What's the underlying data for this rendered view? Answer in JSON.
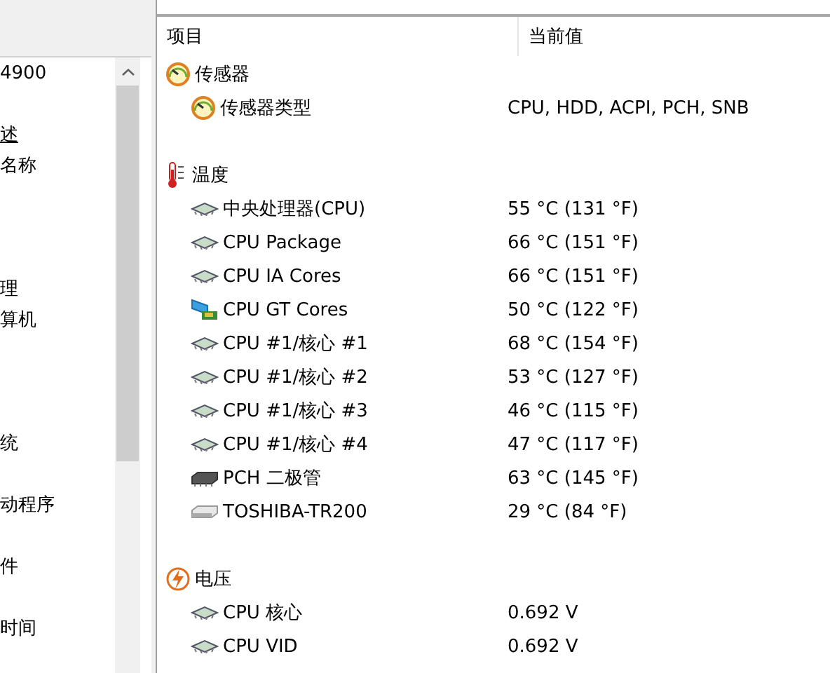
{
  "nav": {
    "items": [
      {
        "kind": "text",
        "label": "4900"
      },
      {
        "kind": "blank"
      },
      {
        "kind": "link",
        "label": "述"
      },
      {
        "kind": "text",
        "label": "名称"
      },
      {
        "kind": "blank"
      },
      {
        "kind": "blank"
      },
      {
        "kind": "blank"
      },
      {
        "kind": "text",
        "label": "理"
      },
      {
        "kind": "text",
        "label": "算机"
      },
      {
        "kind": "blank"
      },
      {
        "kind": "blank"
      },
      {
        "kind": "blank"
      },
      {
        "kind": "text",
        "label": "统"
      },
      {
        "kind": "blank"
      },
      {
        "kind": "text",
        "label": "动程序"
      },
      {
        "kind": "blank"
      },
      {
        "kind": "text",
        "label": "件"
      },
      {
        "kind": "blank"
      },
      {
        "kind": "text",
        "label": "时间"
      }
    ]
  },
  "table": {
    "columns": [
      "项目",
      "当前值"
    ],
    "groups": [
      {
        "title": "传感器",
        "kind": "gauge",
        "items": [
          {
            "name": "传感器类型",
            "value": "CPU, HDD, ACPI, PCH, SNB",
            "kind": "gauge"
          }
        ]
      },
      {
        "title": "温度",
        "kind": "thermometer",
        "items": [
          {
            "name": "中央处理器(CPU)",
            "value": "55 °C  (131 °F)",
            "kind": "chip"
          },
          {
            "name": "CPU Package",
            "value": "66 °C  (151 °F)",
            "kind": "chip"
          },
          {
            "name": "CPU IA Cores",
            "value": "66 °C  (151 °F)",
            "kind": "chip"
          },
          {
            "name": "CPU GT Cores",
            "value": "50 °C  (122 °F)",
            "kind": "gpu"
          },
          {
            "name": "CPU #1/核心 #1",
            "value": "68 °C  (154 °F)",
            "kind": "chip"
          },
          {
            "name": "CPU #1/核心 #2",
            "value": "53 °C  (127 °F)",
            "kind": "chip"
          },
          {
            "name": "CPU #1/核心 #3",
            "value": "46 °C  (115 °F)",
            "kind": "chip"
          },
          {
            "name": "CPU #1/核心 #4",
            "value": "47 °C  (117 °F)",
            "kind": "chip"
          },
          {
            "name": "PCH 二极管",
            "value": "63 °C  (145 °F)",
            "kind": "diode"
          },
          {
            "name": "TOSHIBA-TR200",
            "value": "29 °C  (84 °F)",
            "kind": "drive"
          }
        ]
      },
      {
        "title": "电压",
        "kind": "voltage",
        "items": [
          {
            "name": "CPU 核心",
            "value": "0.692 V",
            "kind": "chip"
          },
          {
            "name": "CPU VID",
            "value": "0.692 V",
            "kind": "chip"
          }
        ]
      }
    ]
  }
}
